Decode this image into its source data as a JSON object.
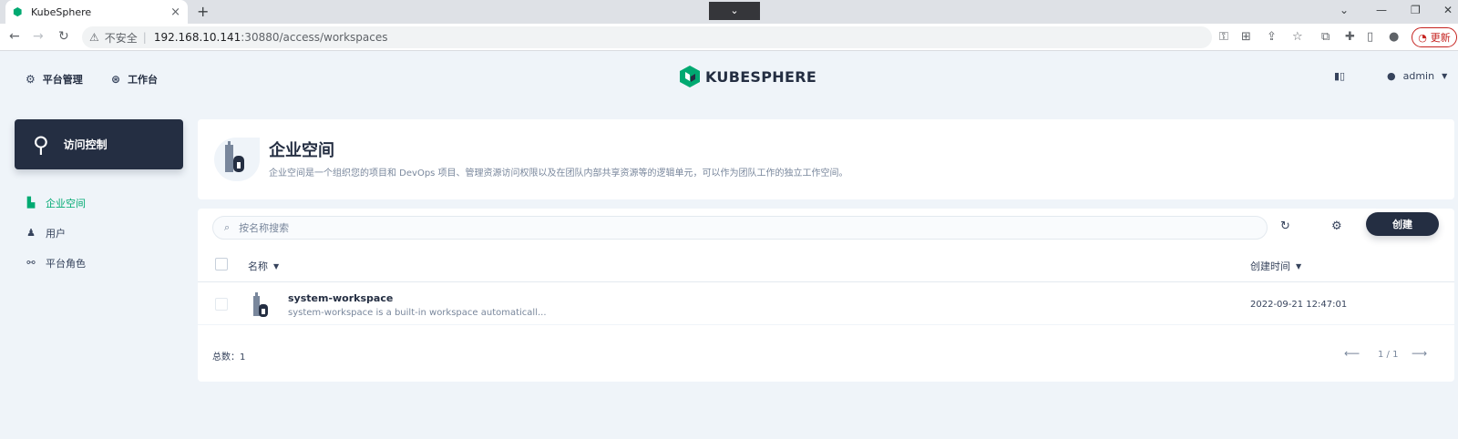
{
  "browser": {
    "tab_title": "KubeSphere",
    "tab_close": "×",
    "new_tab": "+",
    "tab_search": "⌄",
    "minimize": "⌄",
    "win_min": "—",
    "win_restore": "❐",
    "win_close": "✕",
    "back": "←",
    "forward": "→",
    "reload": "↻",
    "security_label": "不安全",
    "separator": "|",
    "url_host": "192.168.10.141",
    "url_path": ":30880/access/workspaces",
    "update_label": "更新"
  },
  "header": {
    "nav": [
      {
        "label": "平台管理",
        "icon": "gear-icon"
      },
      {
        "label": "工作台",
        "icon": "workbench-icon"
      }
    ],
    "logo_text": "KUBESPHERE",
    "user": "admin",
    "brand_color": "#00a971"
  },
  "sidebar": {
    "card_label": "访问控制",
    "items": [
      {
        "label": "企业空间",
        "icon": "workspace-icon",
        "active": true
      },
      {
        "label": "用户",
        "icon": "user-icon",
        "active": false
      },
      {
        "label": "平台角色",
        "icon": "role-icon",
        "active": false
      }
    ]
  },
  "banner": {
    "title": "企业空间",
    "description": "企业空间是一个组织您的项目和 DevOps 项目、管理资源访问权限以及在团队内部共享资源等的逻辑单元，可以作为团队工作的独立工作空间。"
  },
  "table": {
    "search_placeholder": "按名称搜索",
    "create_label": "创建",
    "columns": [
      "名称",
      "创建时间"
    ],
    "rows": [
      {
        "name": "system-workspace",
        "description": "system-workspace is a built-in workspace automaticall...",
        "created": "2022-09-21 12:47:01"
      }
    ],
    "total_label": "总数：1",
    "page_info": "1 / 1"
  }
}
